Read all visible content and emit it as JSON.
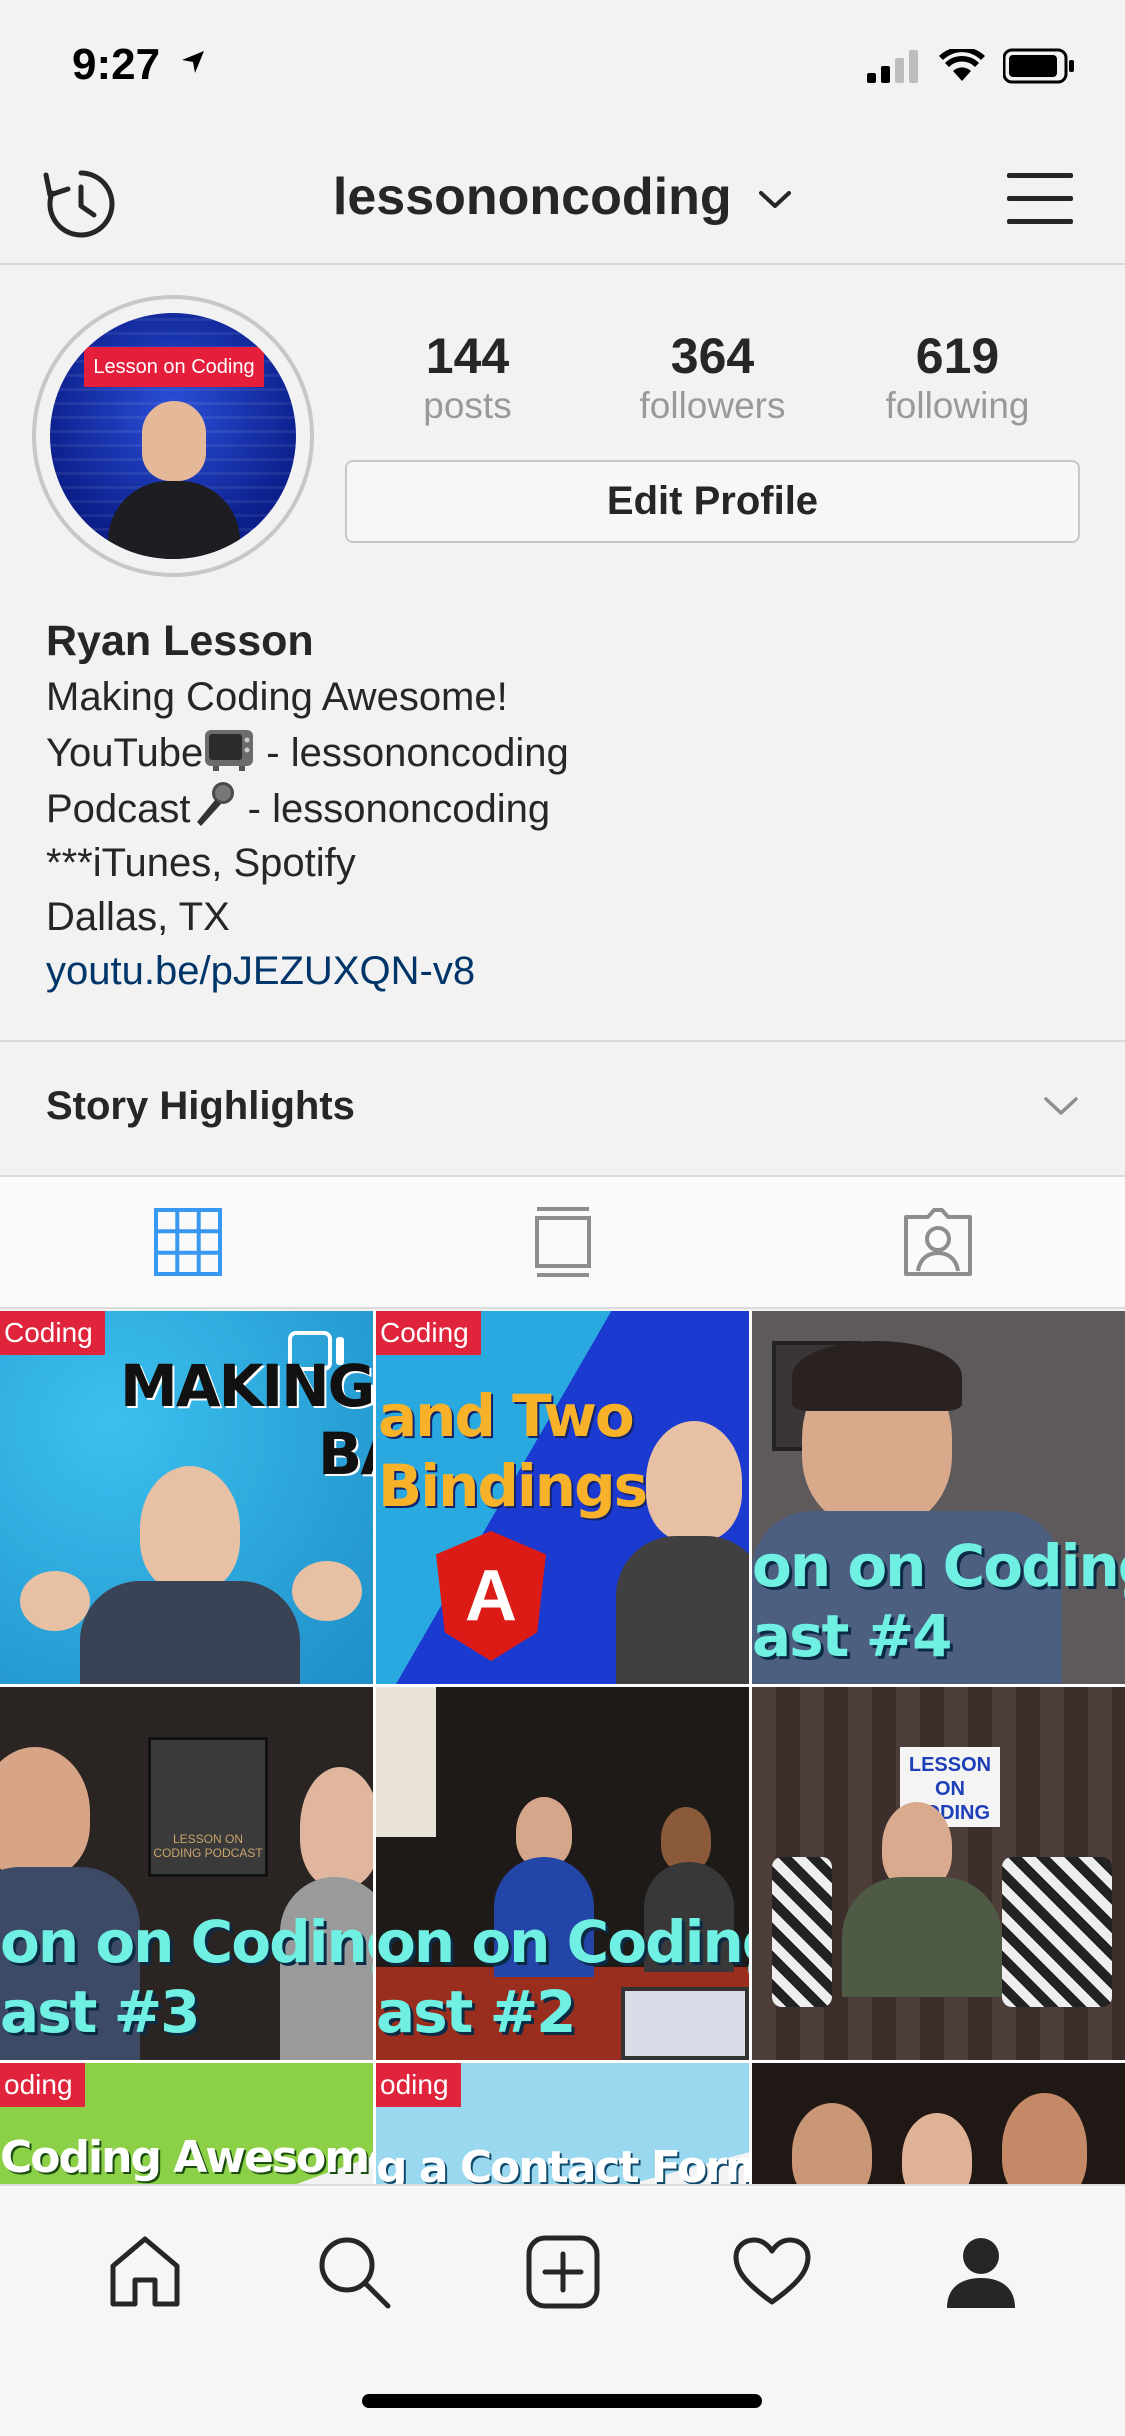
{
  "status_bar": {
    "time": "9:27"
  },
  "nav": {
    "username": "lessononcoding"
  },
  "profile": {
    "avatar_tag": "Lesson on Coding",
    "stats": [
      {
        "value": "144",
        "label": "posts"
      },
      {
        "value": "364",
        "label": "followers"
      },
      {
        "value": "619",
        "label": "following"
      }
    ],
    "edit_button_label": "Edit Profile",
    "bio": {
      "name": "Ryan Lesson",
      "line1": "Making Coding Awesome!",
      "line2_prefix": "YouTube",
      "line2_suffix": " - lessononcoding",
      "line3_prefix": "Podcast",
      "line3_suffix": " - lessononcoding",
      "line4": "***iTunes, Spotify",
      "line5": "Dallas, TX",
      "link": "youtu.be/pJEZUXQN-v8"
    }
  },
  "highlights": {
    "label": "Story Highlights"
  },
  "tabs": [
    {
      "icon": "grid-icon",
      "active": true
    },
    {
      "icon": "feed-icon",
      "active": false
    },
    {
      "icon": "tagged-icon",
      "active": false
    }
  ],
  "posts": [
    {
      "badge": "Coding",
      "caption_top": "MAKING IT",
      "caption_bottom": "BA"
    },
    {
      "badge": "Coding",
      "caption_top": "and Two",
      "caption_bottom": "Bindings",
      "logo": "A"
    },
    {
      "caption_top": "on on Coding",
      "caption_bottom": "ast #4"
    },
    {
      "caption_top": "on on Coding",
      "caption_bottom": "ast #3",
      "mic_sign": "LESSON ON CODING PODCAST"
    },
    {
      "caption_top": "on on Coding",
      "caption_bottom": "ast #2"
    },
    {
      "sign": "LESSON ON CODING"
    },
    {
      "badge": "oding",
      "caption_top": "Coding Awesome"
    },
    {
      "badge": "oding",
      "caption_top": "g a Contact Form"
    },
    {}
  ],
  "colors": {
    "accent_blue": "#3897f0",
    "link": "#003569",
    "text": "#262626",
    "muted": "#999999"
  }
}
